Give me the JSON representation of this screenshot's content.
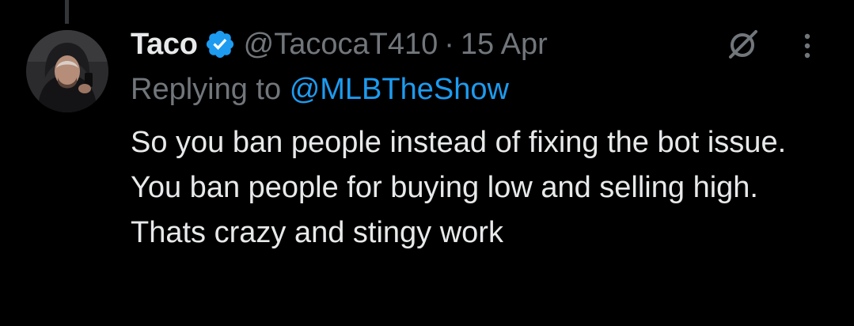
{
  "tweet": {
    "author": {
      "display_name": "Taco",
      "handle": "@TacocaT410",
      "verified": true,
      "avatar_icon": "user-avatar"
    },
    "separator": "·",
    "date": "15 Apr",
    "reply_prefix": "Replying to",
    "reply_to": "@MLBTheShow",
    "text": "So you ban people instead of fixing the bot issue. You ban people for buying low and selling high. Thats crazy and stingy work",
    "actions": {
      "grok_icon": "grok-slash-icon",
      "more_icon": "more-vertical-icon"
    }
  },
  "colors": {
    "background": "#000000",
    "primary_text": "#e7e9ea",
    "secondary_text": "#71767b",
    "link": "#1d9bf0",
    "verified_badge": "#1d9bf0"
  }
}
